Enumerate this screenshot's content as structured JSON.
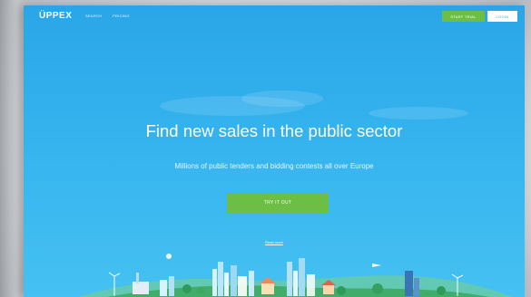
{
  "nav": {
    "logo": "ÜPPEX",
    "links": [
      "SEARCH",
      "PRICING"
    ],
    "start_trial": "START TRIAL",
    "login": "LOGIN"
  },
  "hero": {
    "headline": "Find new sales in the public sector",
    "subline": "Millions of public tenders and bidding contests all over Europe",
    "cta": "TRY IT OUT",
    "read_more": "Read more"
  },
  "colors": {
    "sky_top": "#2aa6e8",
    "sky_bottom": "#45c1f2",
    "accent_green": "#6cbe45",
    "login_bg": "#ffffff"
  },
  "illustration": {
    "icon": "city-skyline-illustration"
  }
}
